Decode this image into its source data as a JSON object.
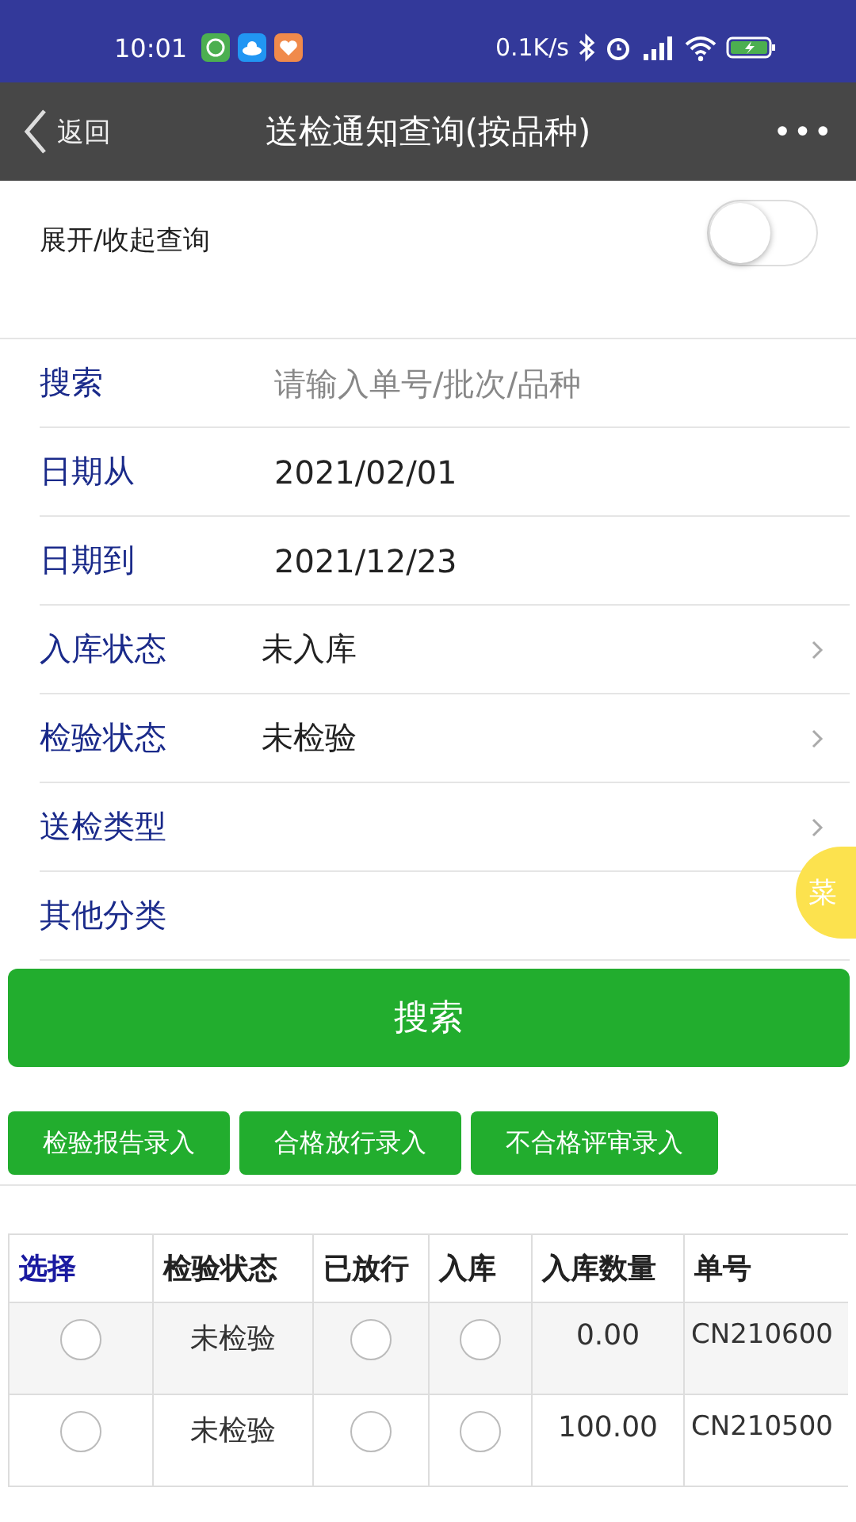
{
  "status_bar": {
    "time": "10:01",
    "net_speed": "0.1K/s"
  },
  "nav": {
    "back": "返回",
    "title": "送检通知查询(按品种)",
    "more": "•••"
  },
  "toggle": {
    "label": "展开/收起查询",
    "on": false
  },
  "form": [
    {
      "kind": "input",
      "label": "搜索",
      "placeholder": "请输入单号/批次/品种"
    },
    {
      "kind": "input",
      "label": "日期从",
      "value": "2021/02/01"
    },
    {
      "kind": "input",
      "label": "日期到",
      "value": "2021/12/23"
    },
    {
      "kind": "select",
      "label": "入库状态",
      "value": "未入库"
    },
    {
      "kind": "select",
      "label": "检验状态",
      "value": "未检验"
    },
    {
      "kind": "select",
      "label": "送检类型"
    },
    {
      "kind": "select",
      "label": "其他分类"
    }
  ],
  "search_button": "搜索",
  "actions": [
    "检验报告录入",
    "合格放行录入",
    "不合格评审录入"
  ],
  "float_button": "菜",
  "table": {
    "columns": [
      "选择",
      "检验状态",
      "已放行",
      "入库",
      "入库数量",
      "单号"
    ],
    "rows": [
      {
        "selected": false,
        "status": "未检验",
        "released": false,
        "stocked": false,
        "quantity": "0.00",
        "number": "CN210600"
      },
      {
        "selected": false,
        "status": "未检验",
        "released": false,
        "stocked": false,
        "quantity": "100.00",
        "number": "CN210500"
      }
    ]
  }
}
